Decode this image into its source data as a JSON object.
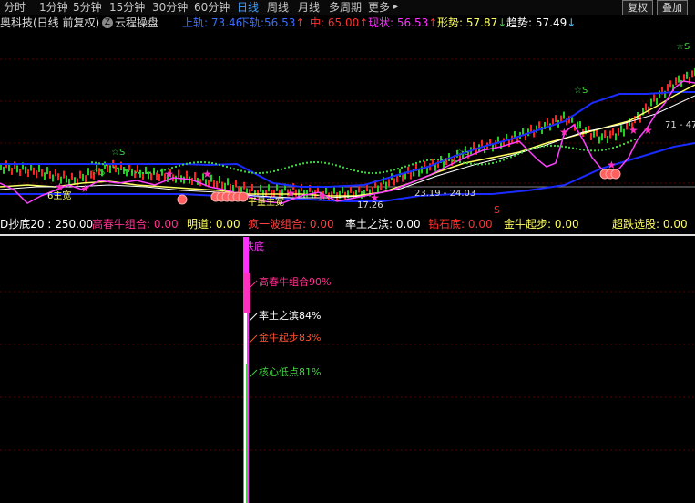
{
  "toolbar": {
    "periods": [
      {
        "label": "分时",
        "active": false
      },
      {
        "label": "1分钟",
        "active": false
      },
      {
        "label": "5分钟",
        "active": false
      },
      {
        "label": "15分钟",
        "active": false
      },
      {
        "label": "30分钟",
        "active": false
      },
      {
        "label": "60分钟",
        "active": false
      },
      {
        "label": "日线",
        "active": true
      },
      {
        "label": "周线",
        "active": false
      },
      {
        "label": "月线",
        "active": false
      },
      {
        "label": "多周期",
        "active": false
      },
      {
        "label": "更多",
        "active": false
      }
    ],
    "more_arrow": "▸",
    "restore_label": "复权",
    "overlay_label": "叠加"
  },
  "main_indicator": {
    "stock_name": "奥科技(日线 前复权)",
    "z_badge": "Z",
    "formula_name": "云程操盘",
    "items": [
      {
        "label": "上轨:",
        "value": "73.46",
        "arrow": "",
        "color": "#3a6dff"
      },
      {
        "label": "下轨:",
        "value": "56.53",
        "arrow": "↑",
        "color": "#3a6dff"
      },
      {
        "label": "中:",
        "value": "65.00",
        "arrow": "↑",
        "color": "#ff3030"
      },
      {
        "label": "现状:",
        "value": "56.53",
        "arrow": "↑",
        "color": "#ff30ff"
      },
      {
        "label": "形势:",
        "value": "57.87",
        "arrow": "↓",
        "color": "#ffff60"
      },
      {
        "label": "趋势:",
        "value": "57.49",
        "arrow": "↓",
        "color": "#ffffff"
      }
    ]
  },
  "price_annotations": {
    "star_label": "☆S",
    "range_label": "23.19 - 24.03",
    "low_label": "17.26",
    "high_label": "71 - 47.",
    "left_label": "6主宽",
    "mid_label": "平量主宽",
    "mark_s": "S",
    "mark_b": "B"
  },
  "sub_indicator": {
    "items": [
      {
        "label": "D抄底20 :",
        "value": "250.00",
        "color": "#ffffff"
      },
      {
        "label": "高春牛组合:",
        "value": "0.00",
        "color": "#ff3090"
      },
      {
        "label": "明道:",
        "value": "0.00",
        "color": "#ffff60"
      },
      {
        "label": "疯一波组合:",
        "value": "0.00",
        "color": "#ff4040"
      },
      {
        "label": "率土之滨:",
        "value": "0.00",
        "color": "#ffffff"
      },
      {
        "label": "钻石底:",
        "value": "0.00",
        "color": "#ff3030"
      },
      {
        "label": "金牛起步:",
        "value": "0.00",
        "color": "#ffff60"
      },
      {
        "label": "超跌选股:",
        "value": "0.00",
        "color": "#ffff60"
      }
    ]
  },
  "lower_panel": {
    "top_label": "跌底",
    "bars": [
      {
        "label": "高春牛组合90%",
        "color": "#ff3090"
      },
      {
        "label": "率土之滨84%",
        "color": "#ffffff"
      },
      {
        "label": "金牛起步83%",
        "color": "#ff5030"
      },
      {
        "label": "核心低点81%",
        "color": "#40d040"
      }
    ]
  },
  "colors": {
    "upper_band": "#1a2bff",
    "mid_line": "#ffffff",
    "yellow_line": "#ffff60",
    "green_line": "#40d040",
    "pink_line": "#ff40ff",
    "candle_up": "#ff2020",
    "candle_down": "#20d020"
  }
}
